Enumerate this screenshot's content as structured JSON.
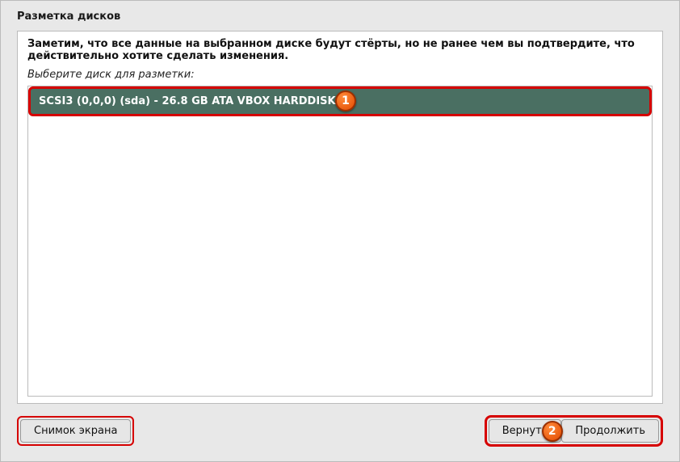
{
  "title": "Разметка дисков",
  "warning": "Заметим, что все данные на выбранном диске будут стёрты, но не ранее чем вы подтвердите, что действительно хотите сделать изменения.",
  "prompt": "Выберите диск для разметки:",
  "disks": [
    {
      "label": "SCSI3 (0,0,0) (sda) - 26.8 GB ATA VBOX HARDDISK"
    }
  ],
  "buttons": {
    "screenshot": "Снимок экрана",
    "back": "Вернуть",
    "continue": "Продолжить"
  },
  "annotations": {
    "badge1": "1",
    "badge2": "2"
  }
}
